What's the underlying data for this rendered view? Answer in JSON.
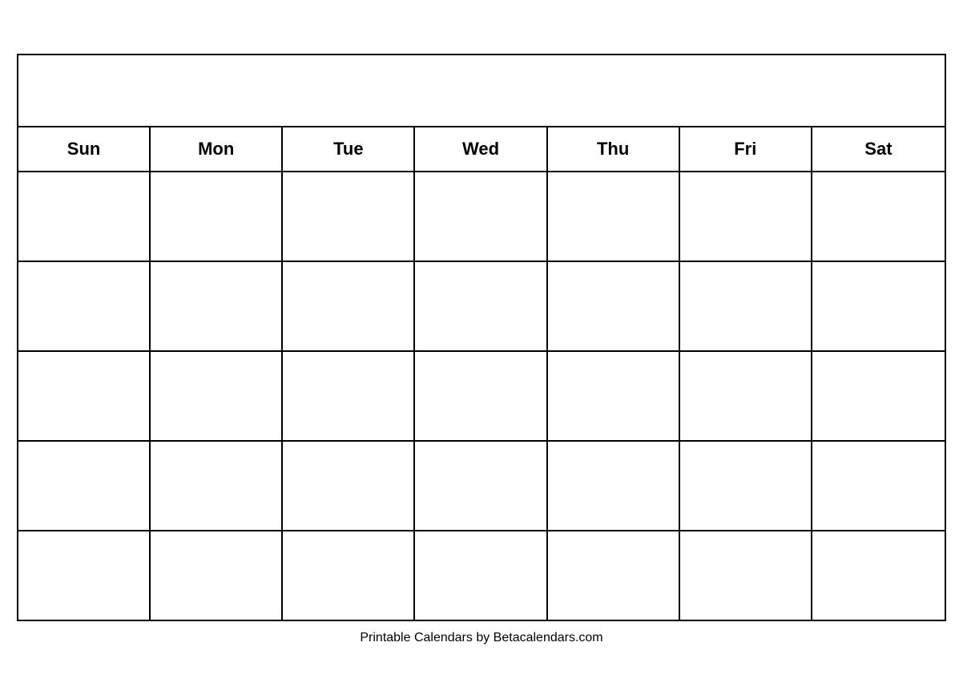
{
  "calendar": {
    "title": "",
    "days": [
      "Sun",
      "Mon",
      "Tue",
      "Wed",
      "Thu",
      "Fri",
      "Sat"
    ],
    "rows": 5
  },
  "footer": {
    "text": "Printable Calendars by Betacalendars.com"
  }
}
